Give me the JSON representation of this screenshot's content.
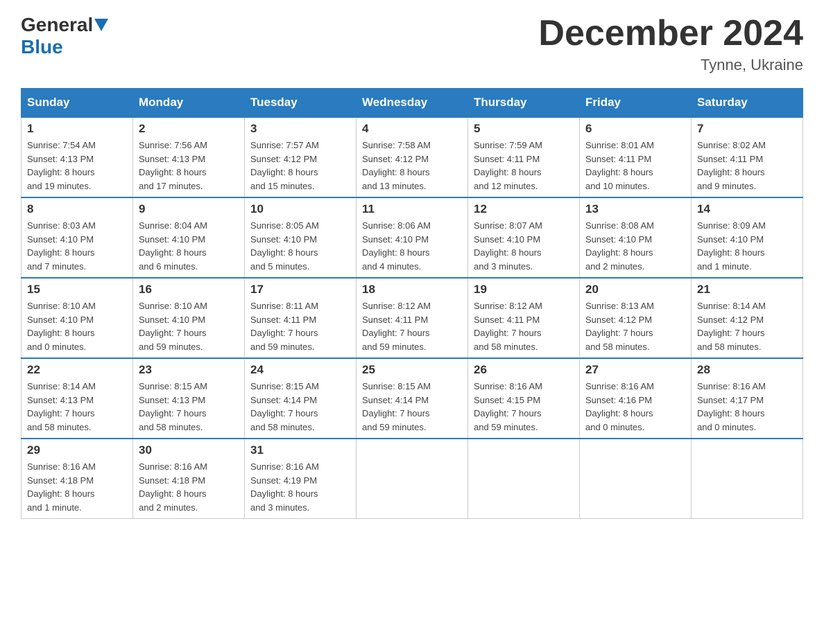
{
  "header": {
    "logo": {
      "general": "General",
      "blue": "Blue"
    },
    "title": "December 2024",
    "subtitle": "Tynne, Ukraine"
  },
  "days_of_week": [
    "Sunday",
    "Monday",
    "Tuesday",
    "Wednesday",
    "Thursday",
    "Friday",
    "Saturday"
  ],
  "weeks": [
    [
      {
        "day": "1",
        "sunrise": "7:54 AM",
        "sunset": "4:13 PM",
        "daylight": "8 hours and 19 minutes."
      },
      {
        "day": "2",
        "sunrise": "7:56 AM",
        "sunset": "4:13 PM",
        "daylight": "8 hours and 17 minutes."
      },
      {
        "day": "3",
        "sunrise": "7:57 AM",
        "sunset": "4:12 PM",
        "daylight": "8 hours and 15 minutes."
      },
      {
        "day": "4",
        "sunrise": "7:58 AM",
        "sunset": "4:12 PM",
        "daylight": "8 hours and 13 minutes."
      },
      {
        "day": "5",
        "sunrise": "7:59 AM",
        "sunset": "4:11 PM",
        "daylight": "8 hours and 12 minutes."
      },
      {
        "day": "6",
        "sunrise": "8:01 AM",
        "sunset": "4:11 PM",
        "daylight": "8 hours and 10 minutes."
      },
      {
        "day": "7",
        "sunrise": "8:02 AM",
        "sunset": "4:11 PM",
        "daylight": "8 hours and 9 minutes."
      }
    ],
    [
      {
        "day": "8",
        "sunrise": "8:03 AM",
        "sunset": "4:10 PM",
        "daylight": "8 hours and 7 minutes."
      },
      {
        "day": "9",
        "sunrise": "8:04 AM",
        "sunset": "4:10 PM",
        "daylight": "8 hours and 6 minutes."
      },
      {
        "day": "10",
        "sunrise": "8:05 AM",
        "sunset": "4:10 PM",
        "daylight": "8 hours and 5 minutes."
      },
      {
        "day": "11",
        "sunrise": "8:06 AM",
        "sunset": "4:10 PM",
        "daylight": "8 hours and 4 minutes."
      },
      {
        "day": "12",
        "sunrise": "8:07 AM",
        "sunset": "4:10 PM",
        "daylight": "8 hours and 3 minutes."
      },
      {
        "day": "13",
        "sunrise": "8:08 AM",
        "sunset": "4:10 PM",
        "daylight": "8 hours and 2 minutes."
      },
      {
        "day": "14",
        "sunrise": "8:09 AM",
        "sunset": "4:10 PM",
        "daylight": "8 hours and 1 minute."
      }
    ],
    [
      {
        "day": "15",
        "sunrise": "8:10 AM",
        "sunset": "4:10 PM",
        "daylight": "8 hours and 0 minutes."
      },
      {
        "day": "16",
        "sunrise": "8:10 AM",
        "sunset": "4:10 PM",
        "daylight": "7 hours and 59 minutes."
      },
      {
        "day": "17",
        "sunrise": "8:11 AM",
        "sunset": "4:11 PM",
        "daylight": "7 hours and 59 minutes."
      },
      {
        "day": "18",
        "sunrise": "8:12 AM",
        "sunset": "4:11 PM",
        "daylight": "7 hours and 59 minutes."
      },
      {
        "day": "19",
        "sunrise": "8:12 AM",
        "sunset": "4:11 PM",
        "daylight": "7 hours and 58 minutes."
      },
      {
        "day": "20",
        "sunrise": "8:13 AM",
        "sunset": "4:12 PM",
        "daylight": "7 hours and 58 minutes."
      },
      {
        "day": "21",
        "sunrise": "8:14 AM",
        "sunset": "4:12 PM",
        "daylight": "7 hours and 58 minutes."
      }
    ],
    [
      {
        "day": "22",
        "sunrise": "8:14 AM",
        "sunset": "4:13 PM",
        "daylight": "7 hours and 58 minutes."
      },
      {
        "day": "23",
        "sunrise": "8:15 AM",
        "sunset": "4:13 PM",
        "daylight": "7 hours and 58 minutes."
      },
      {
        "day": "24",
        "sunrise": "8:15 AM",
        "sunset": "4:14 PM",
        "daylight": "7 hours and 58 minutes."
      },
      {
        "day": "25",
        "sunrise": "8:15 AM",
        "sunset": "4:14 PM",
        "daylight": "7 hours and 59 minutes."
      },
      {
        "day": "26",
        "sunrise": "8:16 AM",
        "sunset": "4:15 PM",
        "daylight": "7 hours and 59 minutes."
      },
      {
        "day": "27",
        "sunrise": "8:16 AM",
        "sunset": "4:16 PM",
        "daylight": "8 hours and 0 minutes."
      },
      {
        "day": "28",
        "sunrise": "8:16 AM",
        "sunset": "4:17 PM",
        "daylight": "8 hours and 0 minutes."
      }
    ],
    [
      {
        "day": "29",
        "sunrise": "8:16 AM",
        "sunset": "4:18 PM",
        "daylight": "8 hours and 1 minute."
      },
      {
        "day": "30",
        "sunrise": "8:16 AM",
        "sunset": "4:18 PM",
        "daylight": "8 hours and 2 minutes."
      },
      {
        "day": "31",
        "sunrise": "8:16 AM",
        "sunset": "4:19 PM",
        "daylight": "8 hours and 3 minutes."
      },
      null,
      null,
      null,
      null
    ]
  ]
}
